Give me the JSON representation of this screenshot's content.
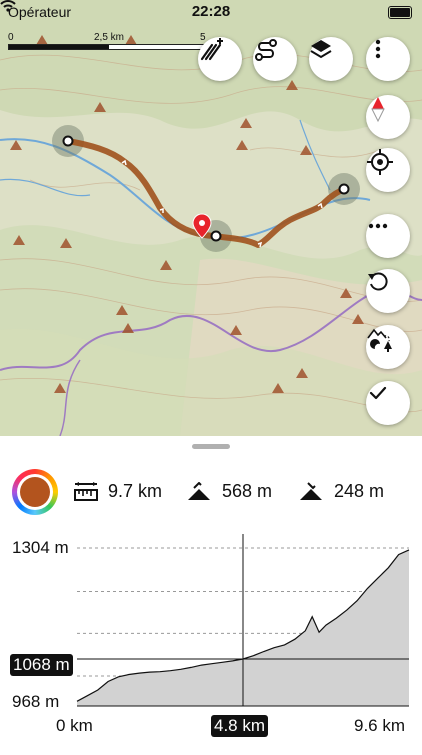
{
  "status_bar": {
    "carrier": "Opérateur",
    "time": "22:28"
  },
  "map": {
    "scale": {
      "labels": [
        "0",
        "2,5 km",
        "5"
      ]
    },
    "controls": {
      "top": [
        "draw-route-icon",
        "route-icon",
        "layers-icon",
        "more-vertical-icon"
      ],
      "right": [
        "compass-icon",
        "locate-icon",
        "more-horizontal-icon",
        "undo-icon",
        "terrain-icon",
        "check-icon"
      ]
    },
    "colors": {
      "track": "#a0521d",
      "marker": "#e8242c"
    }
  },
  "panel": {
    "track_color": "#b3541e",
    "distance": "9.7 km",
    "ascent": "568 m",
    "descent": "248 m"
  },
  "chart_data": {
    "type": "area",
    "y_labels": {
      "top": "1304 m",
      "cursor": "1068 m",
      "bottom": "968 m"
    },
    "x_labels": {
      "start": "0 km",
      "cursor": "4.8 km",
      "end": "9.6 km"
    },
    "xlim": [
      0,
      9.6
    ],
    "ylim": [
      968,
      1304
    ],
    "cursor": {
      "x": 4.8,
      "y": 1068
    },
    "x": [
      0,
      0.3,
      0.6,
      0.9,
      1.2,
      1.5,
      1.8,
      2.1,
      2.4,
      2.7,
      3.0,
      3.3,
      3.6,
      3.9,
      4.2,
      4.5,
      4.8,
      5.1,
      5.4,
      5.7,
      6.0,
      6.3,
      6.6,
      6.8,
      7.0,
      7.2,
      7.5,
      7.8,
      8.1,
      8.4,
      8.7,
      9.0,
      9.3,
      9.6
    ],
    "y": [
      978,
      990,
      1002,
      1020,
      1030,
      1035,
      1038,
      1040,
      1041,
      1043,
      1046,
      1050,
      1055,
      1058,
      1061,
      1064,
      1068,
      1075,
      1084,
      1092,
      1098,
      1110,
      1128,
      1158,
      1125,
      1140,
      1155,
      1172,
      1192,
      1218,
      1240,
      1262,
      1290,
      1300
    ]
  }
}
